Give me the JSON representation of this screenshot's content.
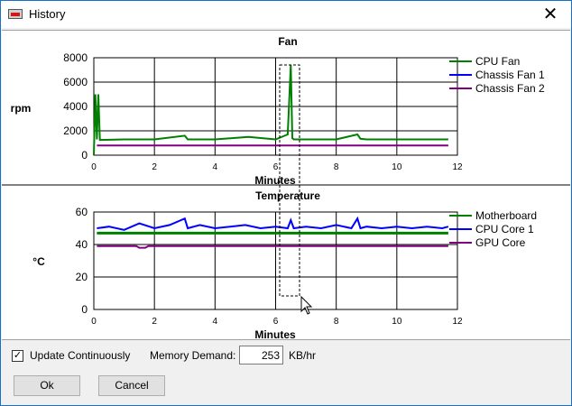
{
  "window": {
    "title": "History",
    "close_glyph": "✕",
    "icon": "app-icon"
  },
  "fan_chart": {
    "type": "line",
    "title": "Fan",
    "ylabel": "rpm",
    "xlabel": "Minutes",
    "xlim": [
      0,
      12
    ],
    "ylim": [
      0,
      8000
    ],
    "x_ticks": [
      "0",
      "2",
      "4",
      "6",
      "8",
      "10",
      "12"
    ],
    "y_ticks": [
      "0",
      "2000",
      "4000",
      "6000",
      "8000"
    ],
    "series": [
      {
        "name": "CPU Fan",
        "color": "#008000",
        "x": [
          0,
          0.05,
          0.1,
          0.15,
          0.2,
          1,
          2,
          3,
          3.1,
          4,
          5.1,
          6,
          6.4,
          6.5,
          6.55,
          6.6,
          7,
          8,
          8.7,
          8.8,
          9,
          10,
          11,
          11.7
        ],
        "y": [
          0,
          5000,
          1300,
          5000,
          1250,
          1300,
          1300,
          1600,
          1300,
          1300,
          1500,
          1300,
          1700,
          7400,
          1400,
          1300,
          1300,
          1300,
          1700,
          1350,
          1300,
          1300,
          1300,
          1300
        ]
      },
      {
        "name": "Chassis Fan 1",
        "color": "#0000ff",
        "x": [],
        "y": []
      },
      {
        "name": "Chassis Fan 2",
        "color": "#800080",
        "x": [
          0.1,
          11.7
        ],
        "y": [
          800,
          800
        ]
      }
    ]
  },
  "temp_chart": {
    "type": "line",
    "title": "Temperature",
    "ylabel": "°C",
    "xlabel": "Minutes",
    "xlim": [
      0,
      12
    ],
    "ylim": [
      0,
      60
    ],
    "x_ticks": [
      "0",
      "2",
      "4",
      "6",
      "8",
      "10",
      "12"
    ],
    "y_ticks": [
      "0",
      "20",
      "40",
      "60"
    ],
    "series": [
      {
        "name": "Motherboard",
        "color": "#008000",
        "x": [
          0.1,
          11.7
        ],
        "y": [
          47,
          47
        ]
      },
      {
        "name": "CPU Core 1",
        "color": "#0000ff",
        "x": [
          0.1,
          0.5,
          1,
          1.5,
          2,
          2.5,
          3,
          3.1,
          3.5,
          4,
          4.5,
          5,
          5.5,
          6,
          6.4,
          6.5,
          6.6,
          7,
          7.5,
          8,
          8.5,
          8.7,
          8.8,
          9,
          9.5,
          10,
          10.5,
          11,
          11.5,
          11.7
        ],
        "y": [
          50,
          51,
          49,
          53,
          50,
          52,
          56,
          50,
          52,
          50,
          51,
          52,
          50,
          51,
          50,
          55,
          50,
          51,
          50,
          52,
          50,
          56,
          50,
          51,
          50,
          51,
          50,
          51,
          50,
          51
        ]
      },
      {
        "name": "GPU Core",
        "color": "#800080",
        "x": [
          0.1,
          1.4,
          1.5,
          1.7,
          1.8,
          11.7
        ],
        "y": [
          39,
          39,
          38,
          38,
          39,
          39
        ]
      }
    ]
  },
  "bottom": {
    "update_checked_glyph": "✓",
    "update_label": "Update Continuously",
    "memory_label": "Memory Demand:",
    "memory_value": "253",
    "memory_unit": "KB/hr",
    "ok_label": "Ok",
    "cancel_label": "Cancel"
  }
}
